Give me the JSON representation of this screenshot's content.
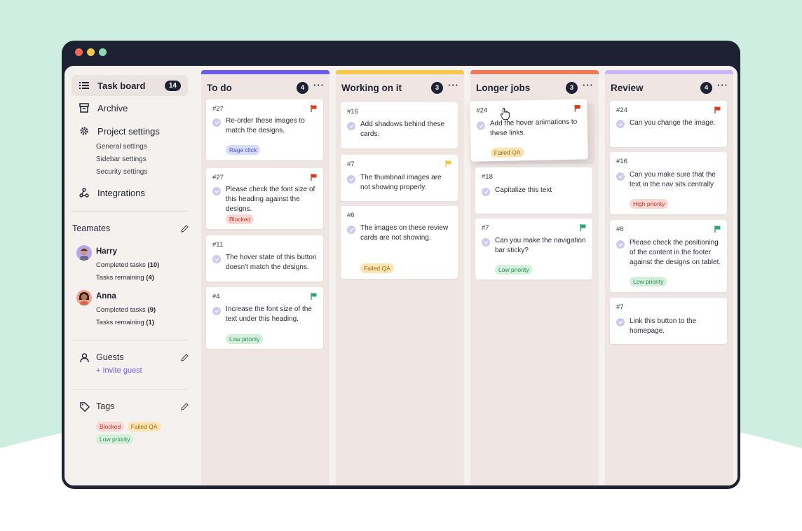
{
  "colors": {
    "accent": "#6c5ce7",
    "todo_bar": "#6c5ce7",
    "working_bar": "#f7c94a",
    "longer_bar": "#ef7c57",
    "review_bar": "#c9b8f5",
    "flag_red": "#d43d1f",
    "flag_yellow": "#f7c94a",
    "flag_green": "#2ea86b"
  },
  "sidebar": {
    "nav": [
      {
        "label": "Task board",
        "count": "14",
        "icon": "list-icon"
      },
      {
        "label": "Archive",
        "icon": "archive-icon"
      },
      {
        "label": "Project settings",
        "icon": "gear-icon"
      },
      {
        "label": "Integrations",
        "icon": "integrations-icon"
      }
    ],
    "settings_sub": [
      "General settings",
      "Sidebar settings",
      "Security settings"
    ],
    "teammates_title": "Teamates",
    "teammates": [
      {
        "name": "Harry",
        "completed_label": "Completed tasks",
        "completed": "(10)",
        "remaining_label": "Tasks remaining",
        "remaining": "(4)"
      },
      {
        "name": "Anna",
        "completed_label": "Completed tasks",
        "completed": "(9)",
        "remaining_label": "Tasks remaining",
        "remaining": "(1)"
      }
    ],
    "guests_title": "Guests",
    "invite_label": "+ Invite guest",
    "tags_title": "Tags",
    "tags": [
      "Blocked",
      "Failed QA",
      "Low priority"
    ]
  },
  "columns": [
    {
      "title": "To do",
      "count": "4",
      "cards": [
        {
          "id": "#27",
          "text": "Re-order these images to match the designs.",
          "tag": "Rage click",
          "flag": "red"
        },
        {
          "id": "#27",
          "text": "Please check the font size of this heading against the designs.",
          "tag": "Blocked",
          "flag": "red"
        },
        {
          "id": "#11",
          "text": "The hover state of this button doesn't match the designs."
        },
        {
          "id": "#4",
          "text": "Increase the font size of the text under this heading.",
          "tag": "Low priority",
          "flag": "green"
        }
      ]
    },
    {
      "title": "Working on it",
      "count": "3",
      "cards": [
        {
          "id": "#16",
          "text": "Add shadows behind these cards."
        },
        {
          "id": "#7",
          "text": "The thumbnail images are not showing properly.",
          "flag": "yellow"
        },
        {
          "id": "#6",
          "text": "The images on these review cards are not showing.",
          "tag": "Failed QA"
        }
      ]
    },
    {
      "title": "Longer jobs",
      "count": "3",
      "cards": [
        {
          "id": "#24",
          "text": "Add the hover animations to these links.",
          "tag": "Failed QA",
          "flag": "red"
        },
        {
          "id": "#18",
          "text": "Capitalize this text"
        },
        {
          "id": "#7",
          "text": "Can you make the navigation bar sticky?",
          "tag": "Low priority",
          "flag": "green"
        }
      ]
    },
    {
      "title": "Review",
      "count": "4",
      "cards": [
        {
          "id": "#24",
          "text": "Can you change the image.",
          "flag": "red"
        },
        {
          "id": "#16",
          "text": "Can you make sure that the text in the nav sits centrally",
          "tag": "High priority"
        },
        {
          "id": "#6",
          "text": "Please check the positioning of the content in the footer against the designs on tablet.",
          "tag": "Low priority",
          "flag": "green"
        },
        {
          "id": "#7",
          "text": "Link this button to the homepage."
        }
      ]
    }
  ]
}
